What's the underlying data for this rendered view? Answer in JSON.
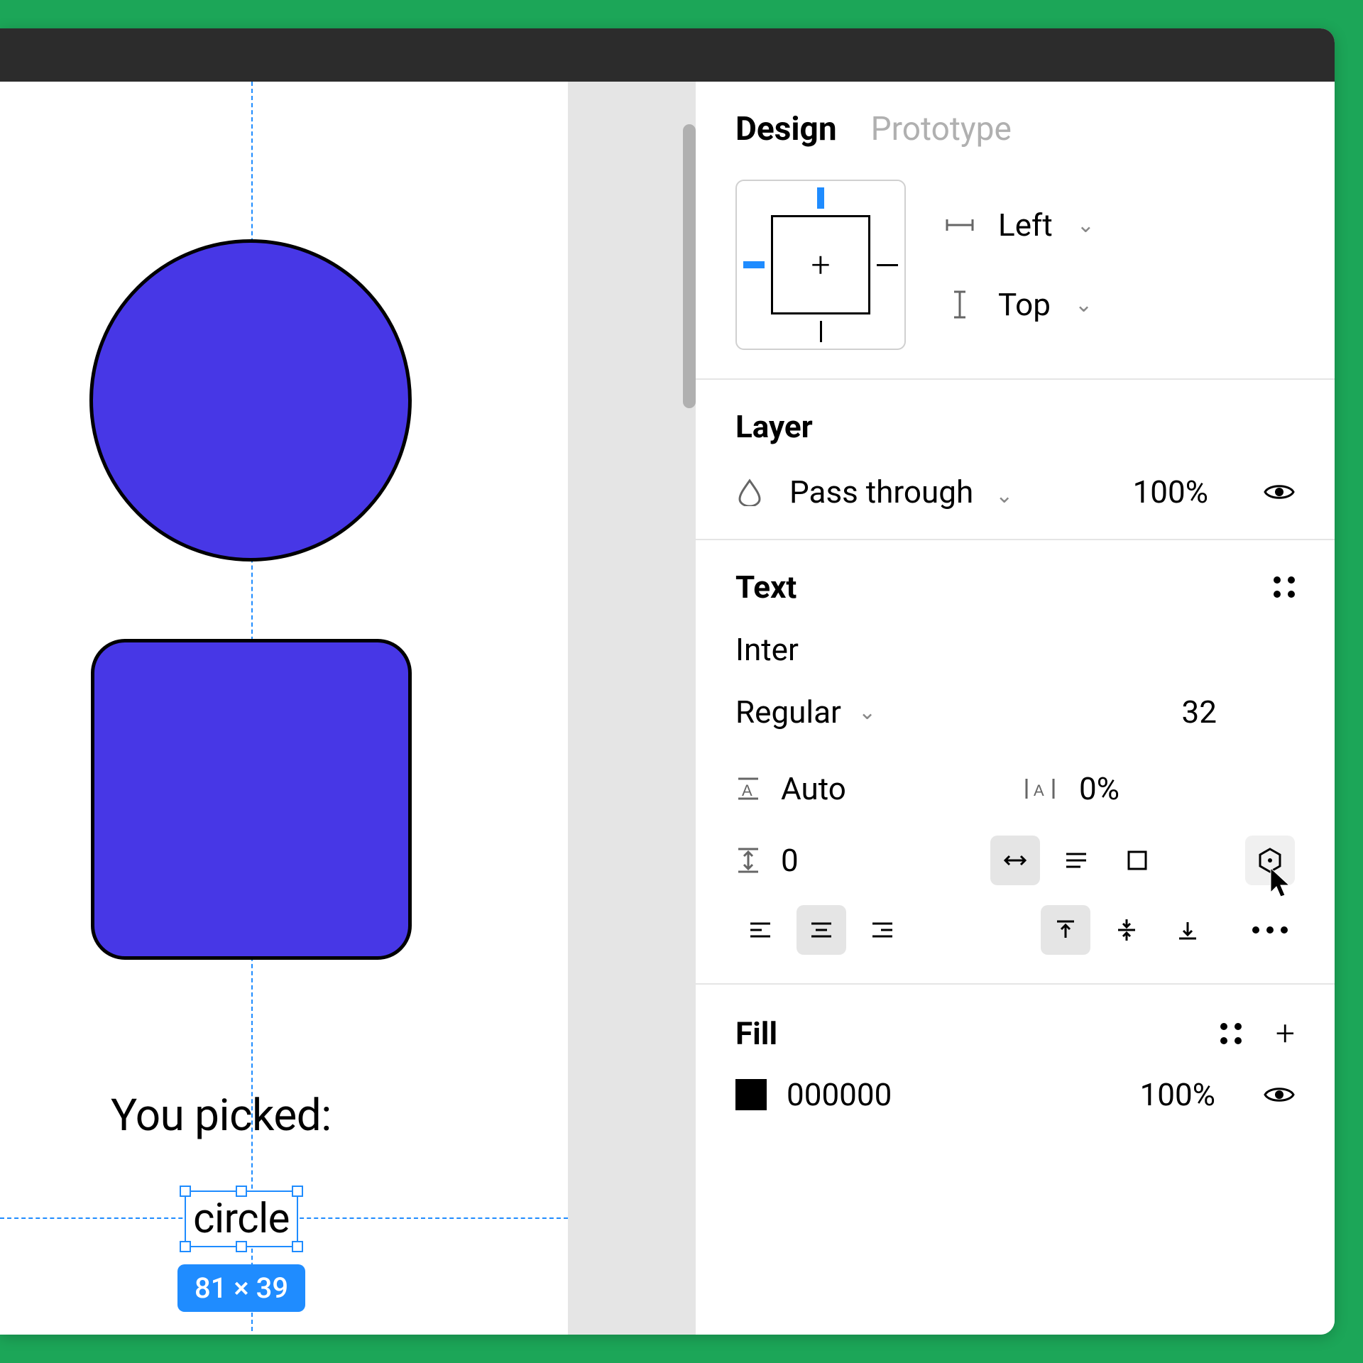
{
  "tabs": {
    "design": "Design",
    "prototype": "Prototype"
  },
  "constraints": {
    "horizontal": "Left",
    "vertical": "Top"
  },
  "layer": {
    "title": "Layer",
    "blend_mode": "Pass through",
    "opacity": "100%"
  },
  "text": {
    "title": "Text",
    "font_family": "Inter",
    "font_weight": "Regular",
    "font_size": "32",
    "line_height": "Auto",
    "letter_spacing": "0%",
    "paragraph_spacing": "0"
  },
  "fill": {
    "title": "Fill",
    "hex": "000000",
    "opacity": "100%"
  },
  "canvas": {
    "label_text": "You picked:",
    "selected_text": "circle",
    "selection_dimensions": "81 × 39"
  }
}
